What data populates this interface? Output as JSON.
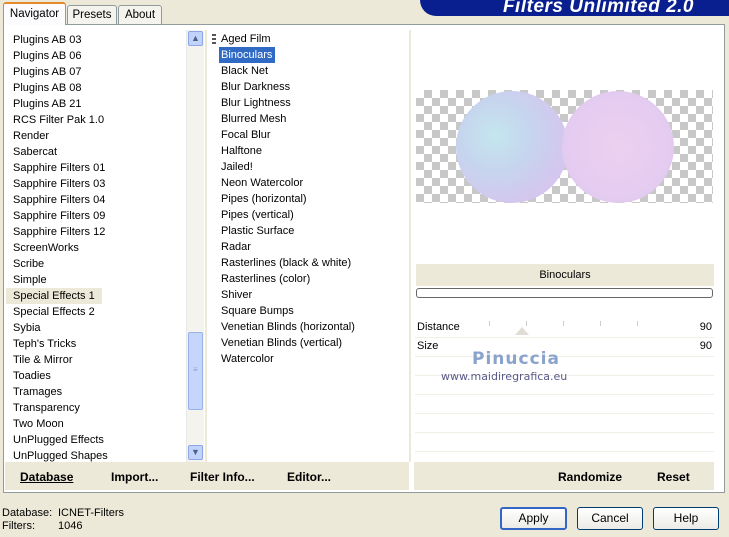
{
  "tabs": [
    "Navigator",
    "Presets",
    "About"
  ],
  "banner_title": "Filters Unlimited 2.0",
  "categories": [
    "Plugins AB 03",
    "Plugins AB 06",
    "Plugins AB 07",
    "Plugins AB 08",
    "Plugins AB 21",
    "RCS Filter Pak 1.0",
    "Render",
    "Sabercat",
    "Sapphire Filters 01",
    "Sapphire Filters 03",
    "Sapphire Filters 04",
    "Sapphire Filters 09",
    "Sapphire Filters 12",
    "ScreenWorks",
    "Scribe",
    "Simple",
    "Special Effects 1",
    "Special Effects 2",
    "Sybia",
    "Teph's Tricks",
    "Tile & Mirror",
    "Toadies",
    "Tramages",
    "Transparency",
    "Two Moon",
    "UnPlugged Effects",
    "UnPlugged Shapes"
  ],
  "selected_category": "Special Effects 1",
  "filters": [
    "Aged Film",
    "Binoculars",
    "Black Net",
    "Blur Darkness",
    "Blur Lightness",
    "Blurred Mesh",
    "Focal Blur",
    "Halftone",
    "Jailed!",
    "Neon Watercolor",
    "Pipes (horizontal)",
    "Pipes (vertical)",
    "Plastic Surface",
    "Radar",
    "Rasterlines (black & white)",
    "Rasterlines (color)",
    "Shiver",
    "Square Bumps",
    "Venetian Blinds (horizontal)",
    "Venetian Blinds (vertical)",
    "Watercolor"
  ],
  "selected_filter": "Binoculars",
  "preview_filter_name": "Binoculars",
  "params": [
    {
      "label": "Distance",
      "value": "90"
    },
    {
      "label": "Size",
      "value": "90"
    }
  ],
  "watermark": {
    "name": "Pinuccia",
    "url": "www.maidiregrafica.eu"
  },
  "buttons": {
    "database": "Database",
    "import": "Import...",
    "filter_info": "Filter Info...",
    "editor": "Editor...",
    "randomize": "Randomize",
    "reset": "Reset",
    "apply": "Apply",
    "cancel": "Cancel",
    "help": "Help"
  },
  "status": {
    "database_label": "Database:",
    "database_value": "ICNET-Filters",
    "filters_label": "Filters:",
    "filters_value": "1046"
  },
  "scrollbar": {
    "up_icon": "▲",
    "down_icon": "▼"
  }
}
